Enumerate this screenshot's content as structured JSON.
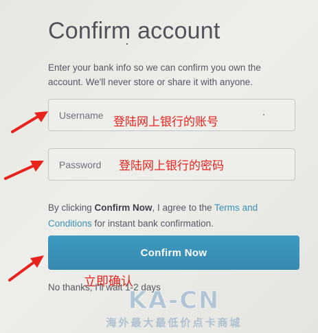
{
  "header": {
    "title": "Confirm account"
  },
  "intro": {
    "text": "Enter your bank info so we can confirm you own the account. We'll never store or share it with anyone."
  },
  "form": {
    "username_placeholder": "Username",
    "password_placeholder": "Password"
  },
  "agreement": {
    "prefix": "By clicking ",
    "bold": "Confirm Now",
    "middle": ", I agree to the ",
    "link": "Terms and Conditions",
    "suffix": " for instant bank confirmation."
  },
  "actions": {
    "confirm_label": "Confirm Now",
    "no_thanks_label": "No thanks, I'll wait 1-2 days"
  },
  "annotations": {
    "username": "登陆网上银行的账号",
    "password": "登陆网上银行的密码",
    "confirm": "立即确认"
  },
  "watermark": {
    "main": "KA-CN",
    "sub": "海外最大最低价点卡商城"
  },
  "colors": {
    "accent": "#3b92b5",
    "button": "#3a8fb8",
    "annotation": "#e8231d"
  }
}
